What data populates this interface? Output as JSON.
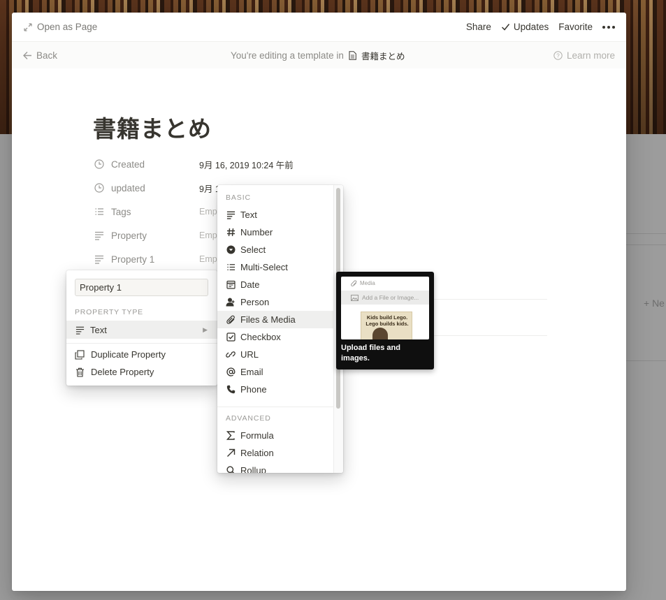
{
  "topbar": {
    "open_as_page": "Open as Page",
    "share": "Share",
    "updates": "Updates",
    "favorite": "Favorite"
  },
  "template_bar": {
    "back": "Back",
    "editing_prefix": "You're editing a template in",
    "page_name": "書籍まとめ",
    "learn_more": "Learn more"
  },
  "page": {
    "title": "書籍まとめ",
    "properties": [
      {
        "name": "Created",
        "icon": "clock-icon",
        "value": "9月 16, 2019 10:24 午前"
      },
      {
        "name": "updated",
        "icon": "clock-icon",
        "value": "9月 1"
      },
      {
        "name": "Tags",
        "icon": "list-icon",
        "value": "Emp"
      },
      {
        "name": "Property",
        "icon": "text-icon",
        "value": "Emp"
      },
      {
        "name": "Property 1",
        "icon": "text-icon",
        "value": "Emp"
      }
    ]
  },
  "editor": {
    "name_value": "Property 1",
    "section_label": "PROPERTY TYPE",
    "type": "Text",
    "duplicate": "Duplicate Property",
    "delete": "Delete Property"
  },
  "dropdown": {
    "basic_label": "BASIC",
    "advanced_label": "ADVANCED",
    "basic": [
      {
        "label": "Text",
        "icon": "text-icon"
      },
      {
        "label": "Number",
        "icon": "hash-icon"
      },
      {
        "label": "Select",
        "icon": "select-icon"
      },
      {
        "label": "Multi-Select",
        "icon": "list-icon"
      },
      {
        "label": "Date",
        "icon": "calendar-icon"
      },
      {
        "label": "Person",
        "icon": "person-icon"
      },
      {
        "label": "Files & Media",
        "icon": "paperclip-icon"
      },
      {
        "label": "Checkbox",
        "icon": "checkbox-icon"
      },
      {
        "label": "URL",
        "icon": "link-icon"
      },
      {
        "label": "Email",
        "icon": "at-icon"
      },
      {
        "label": "Phone",
        "icon": "phone-icon"
      }
    ],
    "advanced": [
      {
        "label": "Formula",
        "icon": "sigma-icon"
      },
      {
        "label": "Relation",
        "icon": "arrow-up-right-icon"
      },
      {
        "label": "Rollup",
        "icon": "search-icon"
      }
    ],
    "highlighted": "Files & Media"
  },
  "tooltip": {
    "preview_header": "Media",
    "preview_add": "Add a File or Image...",
    "preview_image_text": "Kids build Lego. Lego builds kids.",
    "text": "Upload files and images."
  },
  "background": {
    "new_label": "+ Ne"
  }
}
